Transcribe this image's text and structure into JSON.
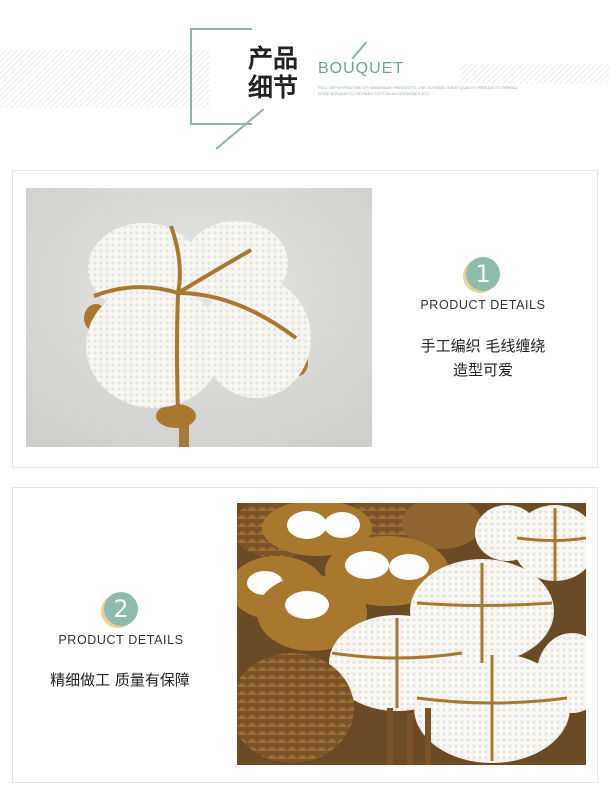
{
  "header": {
    "title_cn_line1": "产品",
    "title_cn_line2": "细节",
    "title_en": "BOUQUET",
    "fine_text": "FULL DEPTH ROUTINE OF HANDMADE PRODUCTS, USE OUTSIDE GOOD QUALITY PRODUCTS THREAD ROSE BOUQUETS, PEONIES COTTON ACCESSORIES ETC"
  },
  "section1": {
    "number": "1",
    "label": "PRODUCT DETAILS",
    "desc_line1": "手工编织 毛线缠绕",
    "desc_line2": "造型可爱"
  },
  "section2": {
    "number": "2",
    "label": "PRODUCT DETAILS",
    "desc_line1": "精细做工 质量有保障"
  },
  "colors": {
    "accent": "#8dbcae",
    "badge_shadow": "#e6d39a",
    "border": "#dfe6e4"
  }
}
